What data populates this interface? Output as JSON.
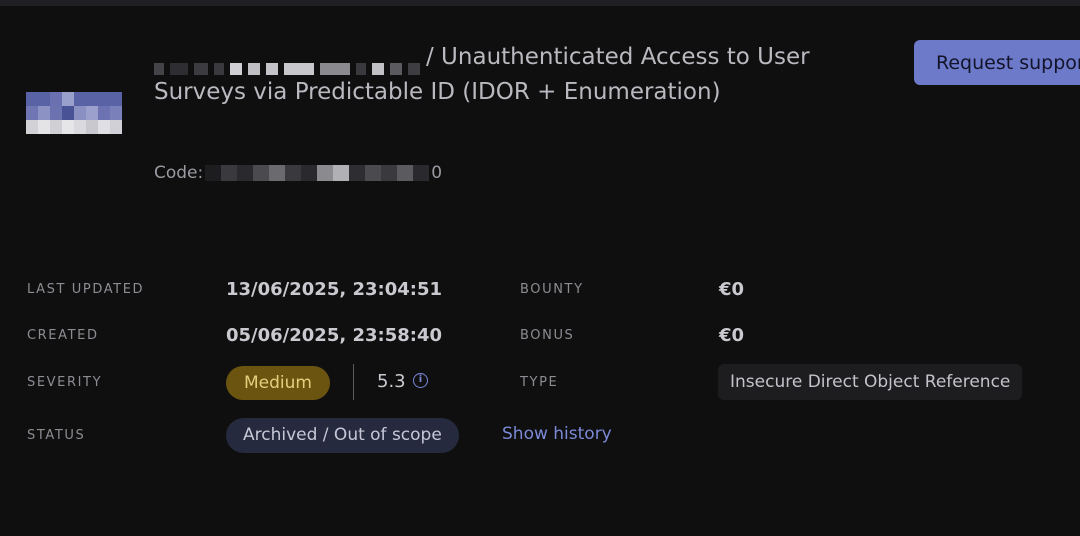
{
  "header": {
    "title_suffix": "/ Unauthenticated Access to User Surveys via Predictable ID (IDOR + Enumeration)",
    "code_label": "Code:",
    "code_tail": "0",
    "request_button": "Request support"
  },
  "details": {
    "last_updated_label": "LAST UPDATED",
    "last_updated_value": "13/06/2025, 23:04:51",
    "created_label": "CREATED",
    "created_value": "05/06/2025, 23:58:40",
    "severity_label": "SEVERITY",
    "severity_badge": "Medium",
    "severity_score": "5.3",
    "status_label": "STATUS",
    "status_value": "Archived / Out of scope",
    "show_history": "Show history",
    "bounty_label": "BOUNTY",
    "bounty_value": "€0",
    "bonus_label": "BONUS",
    "bonus_value": "€0",
    "type_label": "TYPE",
    "type_value": "Insecure Direct Object Reference"
  },
  "colors": {
    "accent": "#6d79c9",
    "severity_medium_bg": "#6b5410",
    "link": "#7b89d6"
  },
  "icons": {
    "info": "info-circle-icon"
  }
}
